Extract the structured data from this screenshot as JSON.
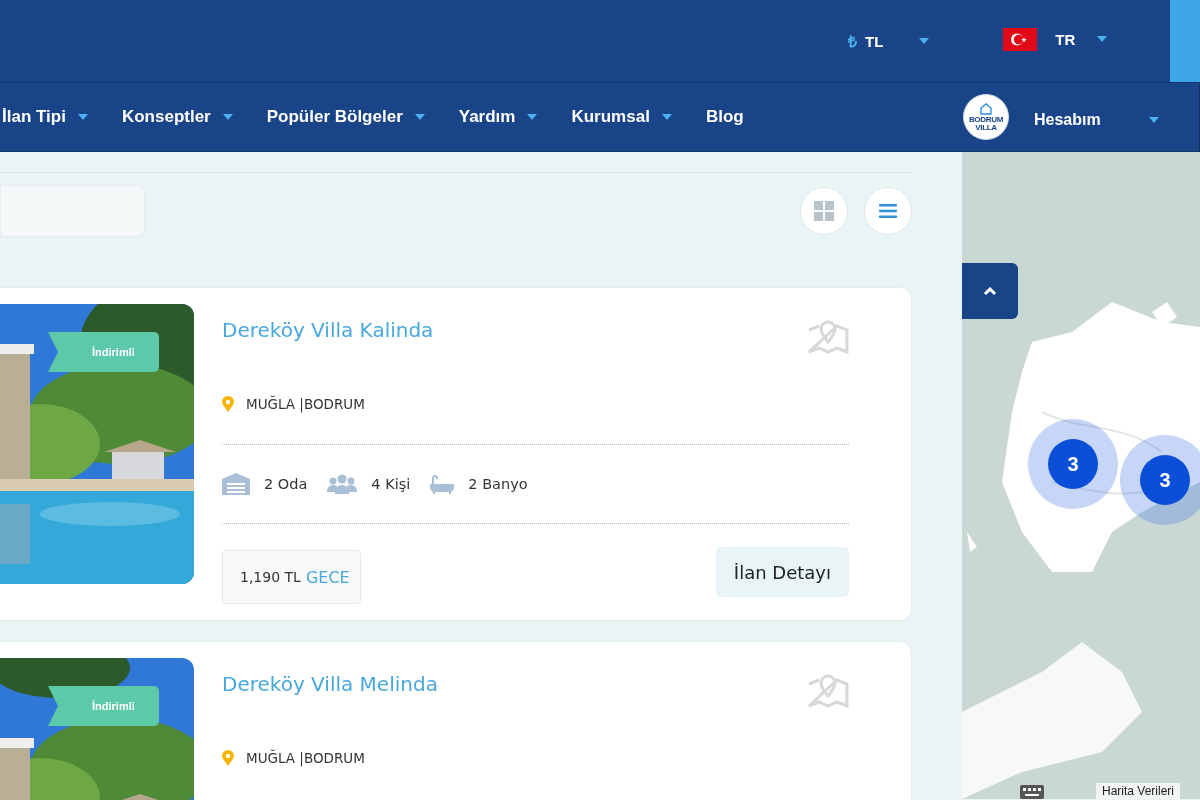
{
  "top_bar": {
    "currency": {
      "symbol": "₺",
      "code": "TL"
    },
    "language": {
      "code": "TR"
    }
  },
  "nav": {
    "items": [
      {
        "label": "İlan Tipi",
        "has_dropdown": true
      },
      {
        "label": "Konseptler",
        "has_dropdown": true
      },
      {
        "label": "Popüler Bölgeler",
        "has_dropdown": true
      },
      {
        "label": "Yardım",
        "has_dropdown": true
      },
      {
        "label": "Kurumsal",
        "has_dropdown": true
      },
      {
        "label": "Blog",
        "has_dropdown": false
      }
    ],
    "account": {
      "logo_lines": [
        "BODRUM",
        "VILLA"
      ],
      "label": "Hesabım"
    }
  },
  "view_buttons": [
    {
      "kind": "grid",
      "selected": false
    },
    {
      "kind": "list",
      "selected": true
    }
  ],
  "listings": [
    {
      "title": "Dereköy Villa Kalinda",
      "badge": "İndirimli",
      "location": "MUĞLA |BODRUM",
      "features": [
        {
          "kind": "rooms",
          "text": "2 Oda"
        },
        {
          "kind": "guests",
          "text": "4 Kişi"
        },
        {
          "kind": "baths",
          "text": "2 Banyo"
        }
      ],
      "price": "1,190 TL",
      "price_unit": "GECE",
      "button": "İlan Detayı"
    },
    {
      "title": "Dereköy Villa Melinda",
      "badge": "İndirimli",
      "location": "MUĞLA |BODRUM"
    }
  ],
  "map": {
    "clusters": [
      {
        "count": "3"
      },
      {
        "count": "3"
      }
    ],
    "attribution": "Harita Verileri"
  }
}
